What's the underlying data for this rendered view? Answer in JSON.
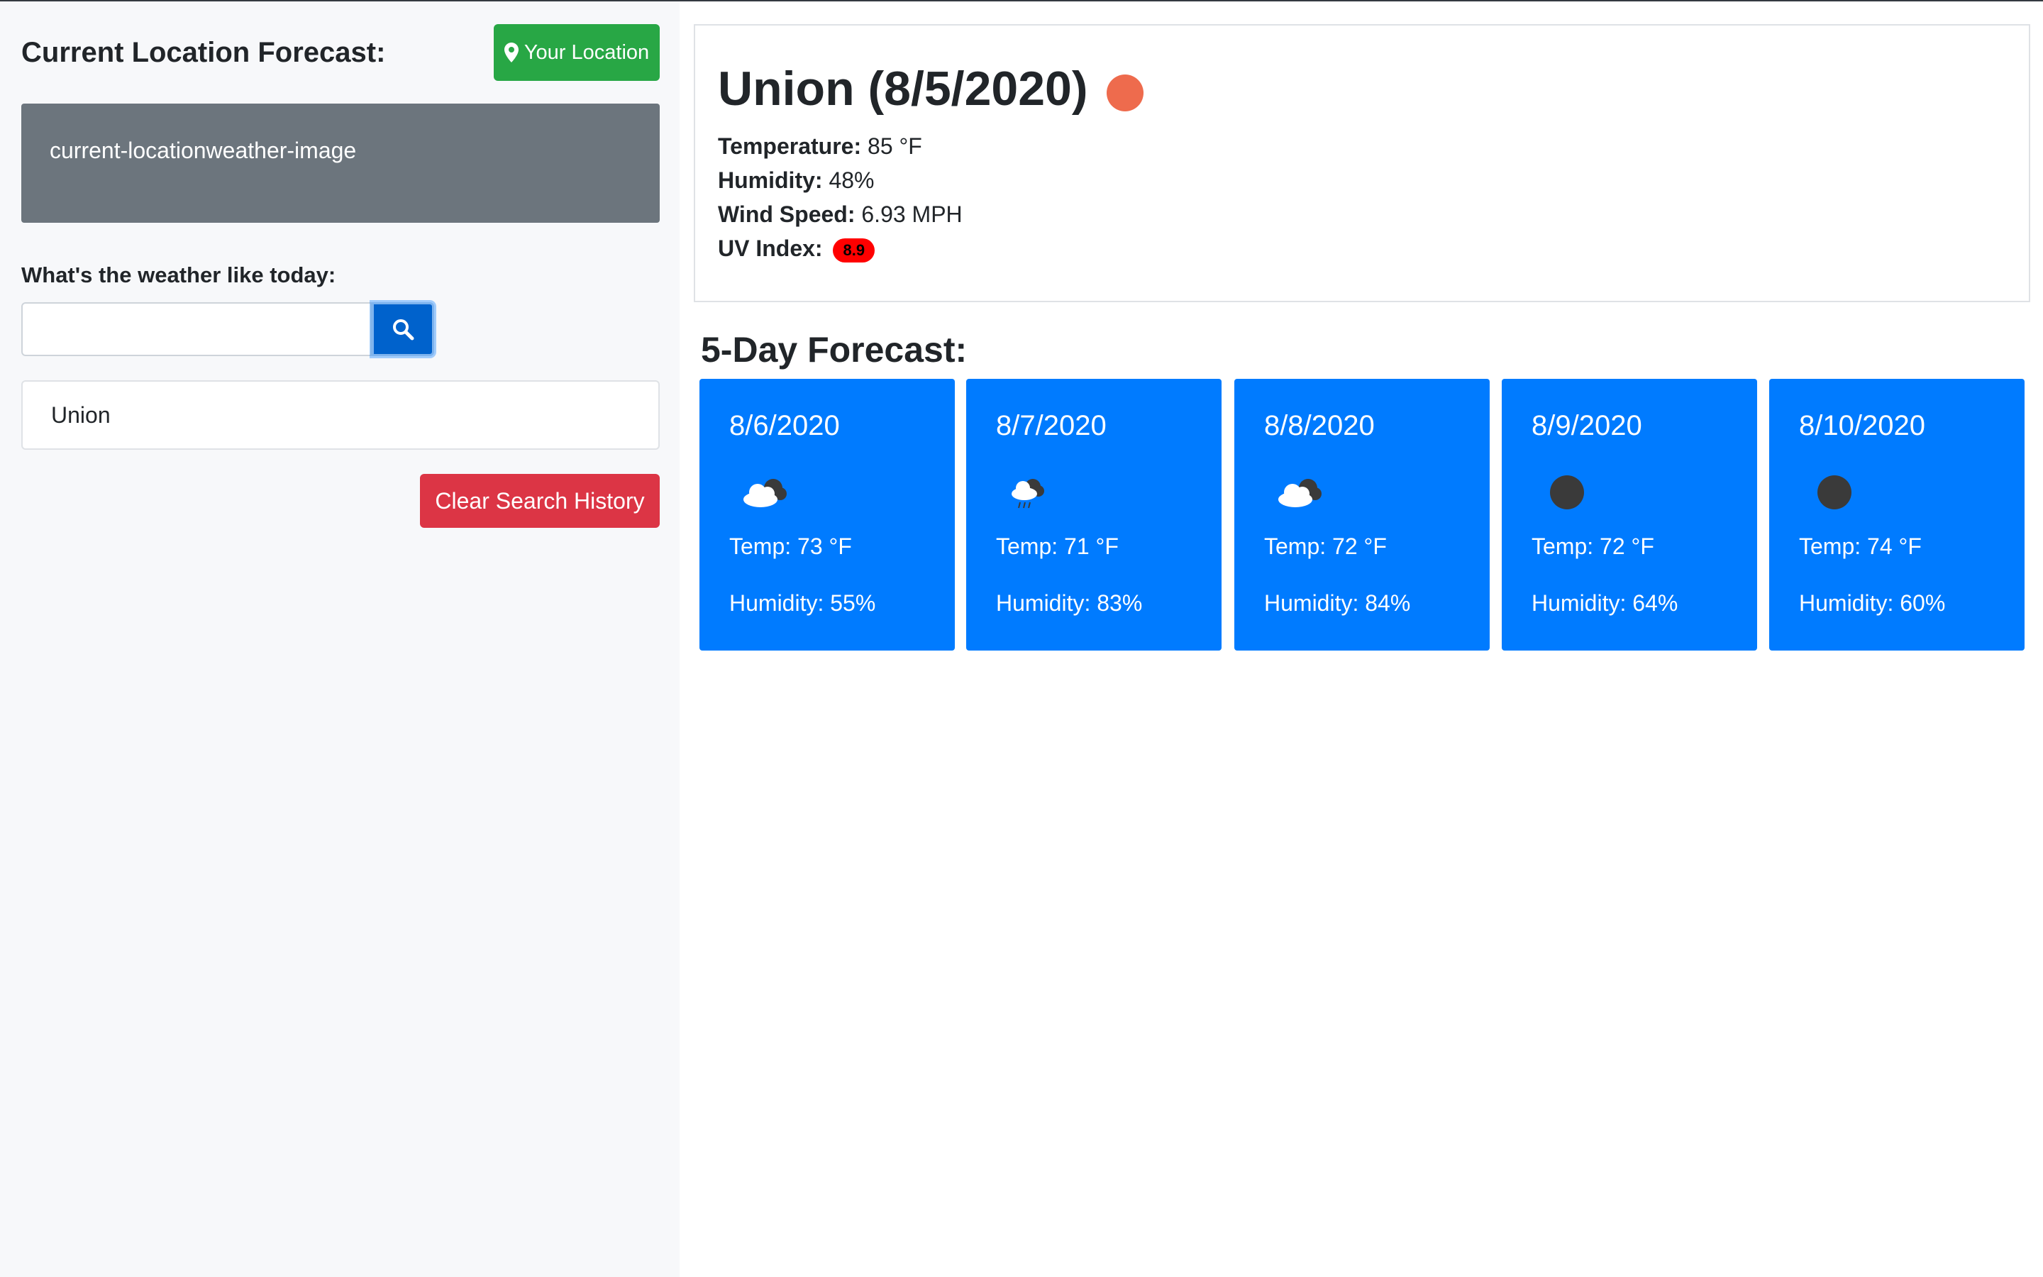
{
  "sidebar": {
    "title": "Current Location Forecast:",
    "location_button": "Your Location",
    "current_image_alt": "current-locationweather-image",
    "search_label": "What's the weather like today:",
    "search_value": "",
    "search_icon": "search-icon",
    "history": [
      "Union"
    ],
    "clear_button": "Clear Search History"
  },
  "current": {
    "title": "Union (8/5/2020)",
    "weather_icon": "sun-icon",
    "temperature_label": "Temperature:",
    "temperature_value": "85 °F",
    "humidity_label": "Humidity:",
    "humidity_value": "48%",
    "wind_label": "Wind Speed:",
    "wind_value": "6.93 MPH",
    "uv_label": "UV Index:",
    "uv_value": "8.9",
    "uv_color": "#ff0000"
  },
  "forecast": {
    "title": "5-Day Forecast:",
    "days": [
      {
        "date": "8/6/2020",
        "icon": "cloud-icon",
        "temp": "Temp: 73 °F",
        "humidity": "Humidity: 55%"
      },
      {
        "date": "8/7/2020",
        "icon": "rain-cloud-icon",
        "temp": "Temp: 71 °F",
        "humidity": "Humidity: 83%"
      },
      {
        "date": "8/8/2020",
        "icon": "cloud-icon",
        "temp": "Temp: 72 °F",
        "humidity": "Humidity: 84%"
      },
      {
        "date": "8/9/2020",
        "icon": "night-icon",
        "temp": "Temp: 72 °F",
        "humidity": "Humidity: 64%"
      },
      {
        "date": "8/10/2020",
        "icon": "night-icon",
        "temp": "Temp: 74 °F",
        "humidity": "Humidity: 60%"
      }
    ]
  },
  "colors": {
    "primary": "#007bff",
    "success": "#28a745",
    "danger": "#dc3545",
    "secondary": "#6c757d",
    "sun": "#ee6b4d"
  }
}
